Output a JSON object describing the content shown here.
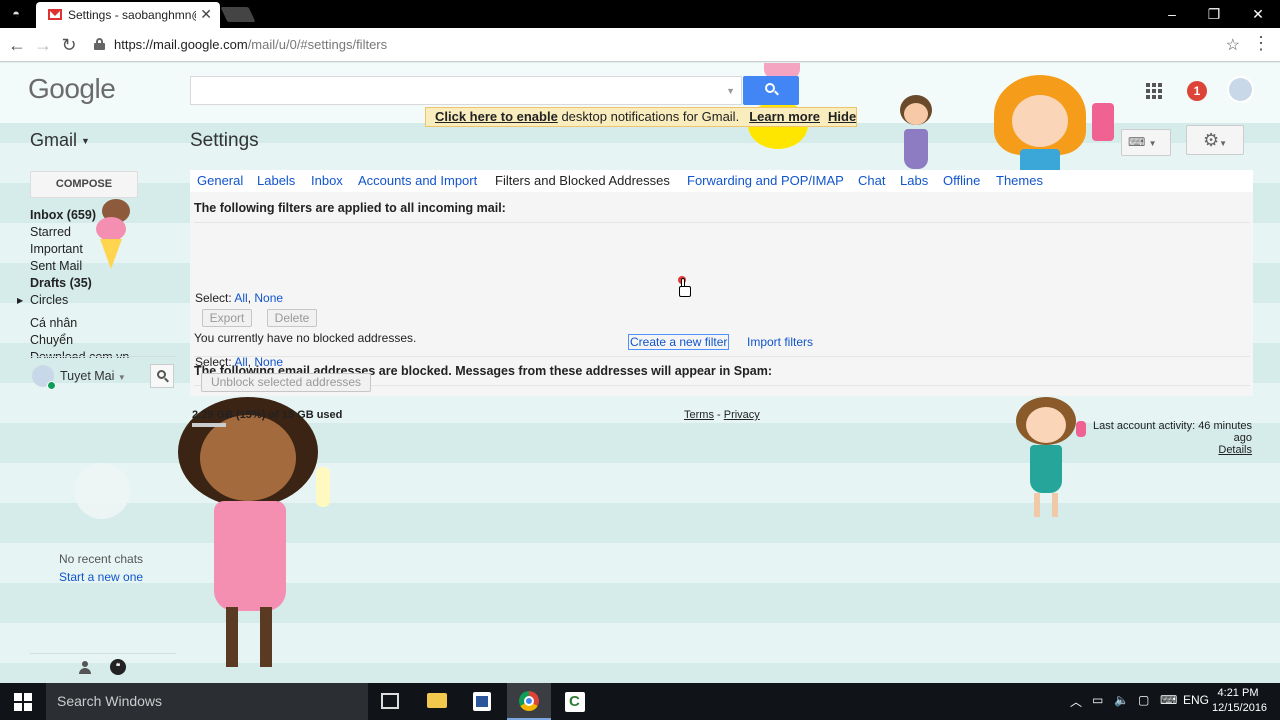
{
  "browser": {
    "tab_title": "Settings - saobanghmn@",
    "url_host": "https://mail.google.com",
    "url_path": "/mail/u/0/#settings/filters",
    "window_buttons": [
      "–",
      "❐",
      "✕"
    ]
  },
  "header": {
    "logo": "Google",
    "notification_count": "1"
  },
  "notification_bar": {
    "enable_link": "Click here to enable",
    "text": " desktop notifications for Gmail.",
    "learn_more": "Learn more",
    "hide": "Hide"
  },
  "app": {
    "gmail_label": "Gmail",
    "page_title": "Settings",
    "compose": "COMPOSE"
  },
  "sidebar": {
    "items": [
      {
        "label": "Inbox (659)",
        "bold": true
      },
      {
        "label": "Starred"
      },
      {
        "label": "Important"
      },
      {
        "label": "Sent Mail"
      },
      {
        "label": "Drafts (35)",
        "bold": true
      },
      {
        "label": "Circles"
      },
      {
        "label": "Cá nhân"
      },
      {
        "label": "Chuyển"
      },
      {
        "label": "Download com.vn"
      }
    ]
  },
  "chat": {
    "user_name": "Tuyet Mai",
    "no_recent": "No recent chats",
    "start_new": "Start a new one"
  },
  "tabs": [
    "General",
    "Labels",
    "Inbox",
    "Accounts and Import",
    "Filters and Blocked Addresses",
    "Forwarding and POP/IMAP",
    "Chat",
    "Labs",
    "Offline",
    "Themes"
  ],
  "filters_section": {
    "heading": "The following filters are applied to all incoming mail:",
    "select_label": "Select:",
    "select_all": "All",
    "select_none": "None",
    "export_btn": "Export",
    "delete_btn": "Delete",
    "create_filter": "Create a new filter",
    "import_filters": "Import filters"
  },
  "blocked_section": {
    "heading": "The following email addresses are blocked. Messages from these addresses will appear in Spam:",
    "empty_text": "You currently have no blocked addresses.",
    "select_label": "Select:",
    "select_all": "All",
    "select_none": "None",
    "unblock_btn": "Unblock selected addresses"
  },
  "footer": {
    "storage": "2.29 GB (15%) of 15 GB used",
    "terms": "Terms",
    "separator": " - ",
    "privacy": "Privacy",
    "last_activity": "Last account activity: 46 minutes ago",
    "details": "Details"
  },
  "taskbar": {
    "search_placeholder": "Search Windows",
    "language": "ENG",
    "time": "4:21 PM",
    "date": "12/15/2016"
  },
  "colors": {
    "accent_blue": "#4285f4",
    "link_blue": "#1155cc",
    "badge_red": "#db4437",
    "notify_bg": "#f9edbe"
  }
}
